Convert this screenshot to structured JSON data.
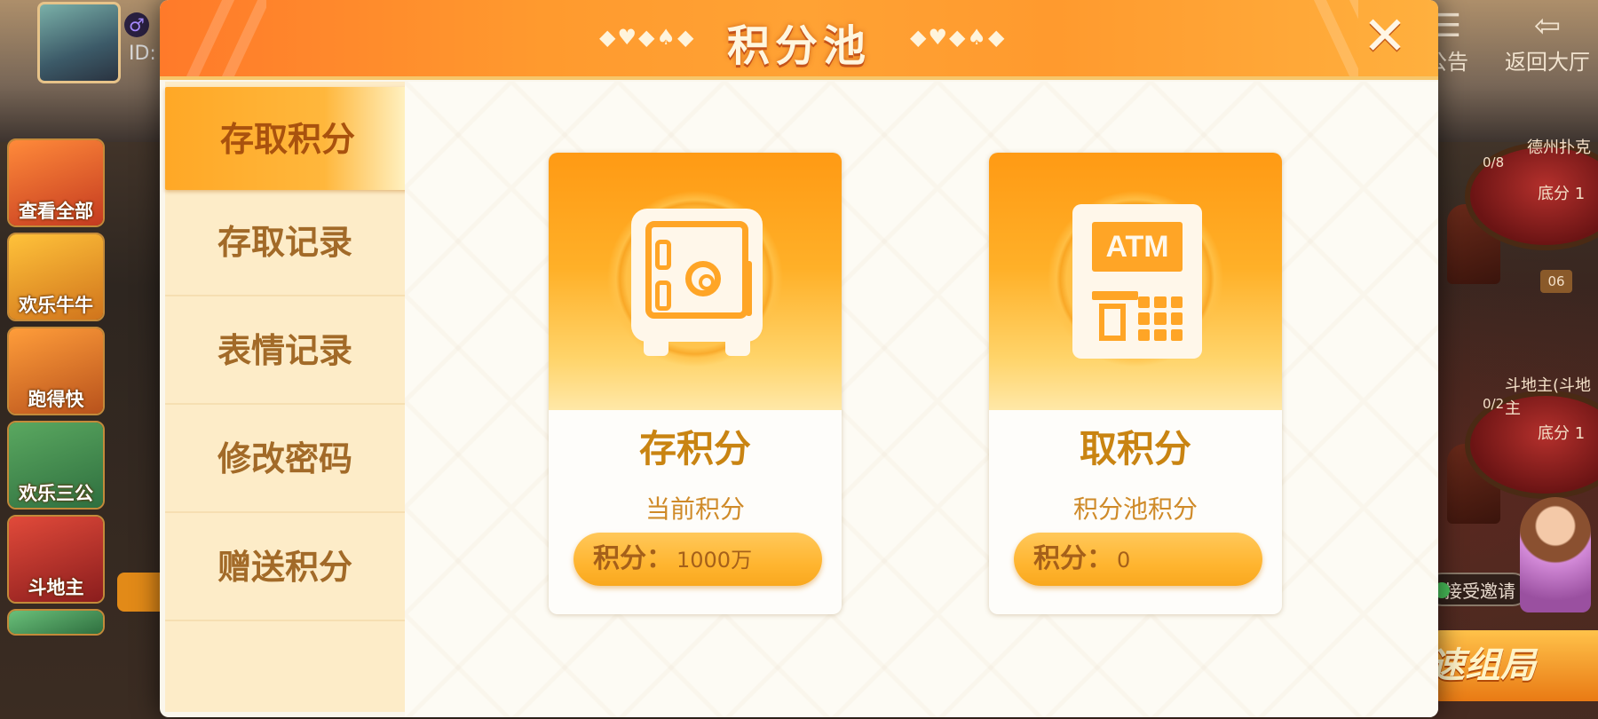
{
  "lobby": {
    "user_id_label": "ID:",
    "gender_symbol": "♂",
    "games": [
      {
        "name": "查看全部"
      },
      {
        "name": "欢乐牛牛"
      },
      {
        "name": "跑得快"
      },
      {
        "name": "欢乐三公"
      },
      {
        "name": "斗地主"
      }
    ],
    "notice_label": "公告",
    "back_label": "返回大厅",
    "table_1": {
      "name": "德州扑克",
      "seats": "0/8",
      "base": "底分 1",
      "badge": "06"
    },
    "table_2": {
      "name": "斗地主(斗地主",
      "seats": "0/2",
      "base": "底分 1"
    },
    "invite_label": "接受邀请",
    "quick_label": "速组局"
  },
  "modal": {
    "title": "积分池",
    "deco": "◆♥◆♠◆",
    "close_glyph": "✕",
    "menu": [
      {
        "label": "存取积分",
        "active": true
      },
      {
        "label": "存取记录",
        "active": false
      },
      {
        "label": "表情记录",
        "active": false
      },
      {
        "label": "修改密码",
        "active": false
      },
      {
        "label": "赠送积分",
        "active": false
      }
    ],
    "cards": {
      "save": {
        "icon": "safe-icon",
        "title": "存积分",
        "subtitle": "当前积分",
        "pill_label": "积分：",
        "pill_value": "1000万"
      },
      "take": {
        "icon": "atm-icon",
        "atm_text": "ATM",
        "title": "取积分",
        "subtitle": "积分池积分",
        "pill_label": "积分：",
        "pill_value": "0"
      }
    }
  },
  "colors": {
    "header_orange": "#ff9a2e",
    "menu_active": "#ffa826",
    "menu_bg": "#fdecc8",
    "card_gold": "#c98412",
    "pill_orange": "#ffb530"
  }
}
